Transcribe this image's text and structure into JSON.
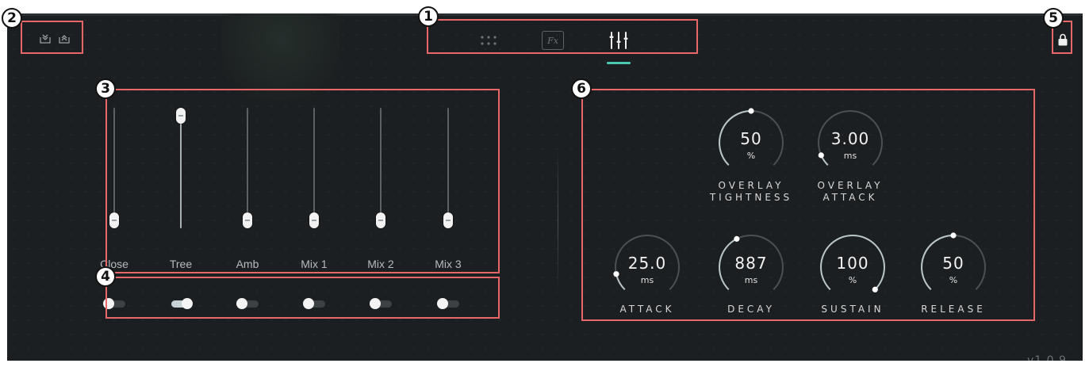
{
  "top_tabs": [
    {
      "icon": "grid-dots-icon",
      "label": "",
      "active": false
    },
    {
      "icon": "fx-icon",
      "label": "Fx",
      "active": false
    },
    {
      "icon": "mixer-sliders-icon",
      "label": "",
      "active": true
    }
  ],
  "top_left_buttons": [
    {
      "icon": "collapse-down-icon"
    },
    {
      "icon": "expand-up-icon"
    }
  ],
  "lock": {
    "icon": "lock-icon"
  },
  "annotations": [
    "1",
    "2",
    "3",
    "4",
    "5",
    "6"
  ],
  "channels": [
    {
      "label": "Close",
      "level": 0.0,
      "enabled": false
    },
    {
      "label": "Tree",
      "level": 1.0,
      "enabled": true
    },
    {
      "label": "Amb",
      "level": 0.0,
      "enabled": false
    },
    {
      "label": "Mix 1",
      "level": 0.0,
      "enabled": false
    },
    {
      "label": "Mix 2",
      "level": 0.0,
      "enabled": false
    },
    {
      "label": "Mix 3",
      "level": 0.0,
      "enabled": false
    }
  ],
  "knobs": [
    {
      "label_line1": "OVERLAY",
      "label_line2": "TIGHTNESS",
      "value": "50",
      "unit": "%",
      "position": 0.5
    },
    {
      "label_line1": "OVERLAY",
      "label_line2": "ATTACK",
      "value": "3.00",
      "unit": "ms",
      "position": 0.08
    },
    {
      "label_line1": "ATTACK",
      "label_line2": "",
      "value": "25.0",
      "unit": "ms",
      "position": 0.12
    },
    {
      "label_line1": "DECAY",
      "label_line2": "",
      "value": "887",
      "unit": "ms",
      "position": 0.4
    },
    {
      "label_line1": "SUSTAIN",
      "label_line2": "",
      "value": "100",
      "unit": "%",
      "position": 1.0
    },
    {
      "label_line1": "RELEASE",
      "label_line2": "",
      "value": "50",
      "unit": "%",
      "position": 0.5
    }
  ],
  "version": "v1.0.9",
  "colors": {
    "background": "#1c1f21",
    "accent": "#4bc6b2",
    "annotation": "#e8686a"
  }
}
